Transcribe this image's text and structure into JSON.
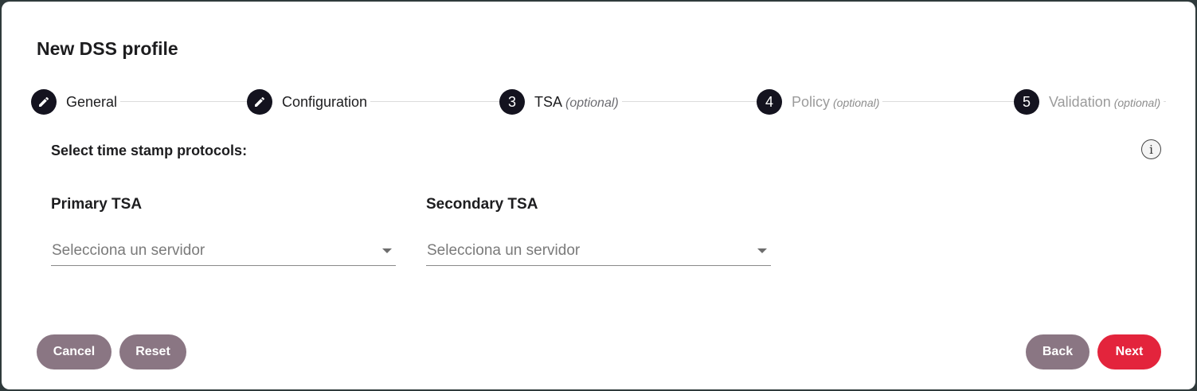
{
  "dialog": {
    "title": "New DSS profile"
  },
  "stepper": {
    "steps": [
      {
        "number": "",
        "icon": "pencil-icon",
        "label": "General",
        "optional": ""
      },
      {
        "number": "",
        "icon": "pencil-icon",
        "label": "Configuration",
        "optional": ""
      },
      {
        "number": "3",
        "icon": "",
        "label": "TSA",
        "optional": "(optional)"
      },
      {
        "number": "4",
        "icon": "",
        "label": "Policy",
        "optional": "(optional)"
      },
      {
        "number": "5",
        "icon": "",
        "label": "Validation",
        "optional": "(optional)"
      }
    ]
  },
  "form": {
    "section_title": "Select time stamp protocols:",
    "info_icon": "i",
    "primary": {
      "label": "Primary TSA",
      "placeholder": "Selecciona un servidor"
    },
    "secondary": {
      "label": "Secondary TSA",
      "placeholder": "Selecciona un servidor"
    }
  },
  "actions": {
    "cancel": "Cancel",
    "reset": "Reset",
    "back": "Back",
    "next": "Next"
  },
  "colors": {
    "step_dark": "#14131f",
    "secondary_button": "#8a7683",
    "primary_button": "#e3243c"
  }
}
